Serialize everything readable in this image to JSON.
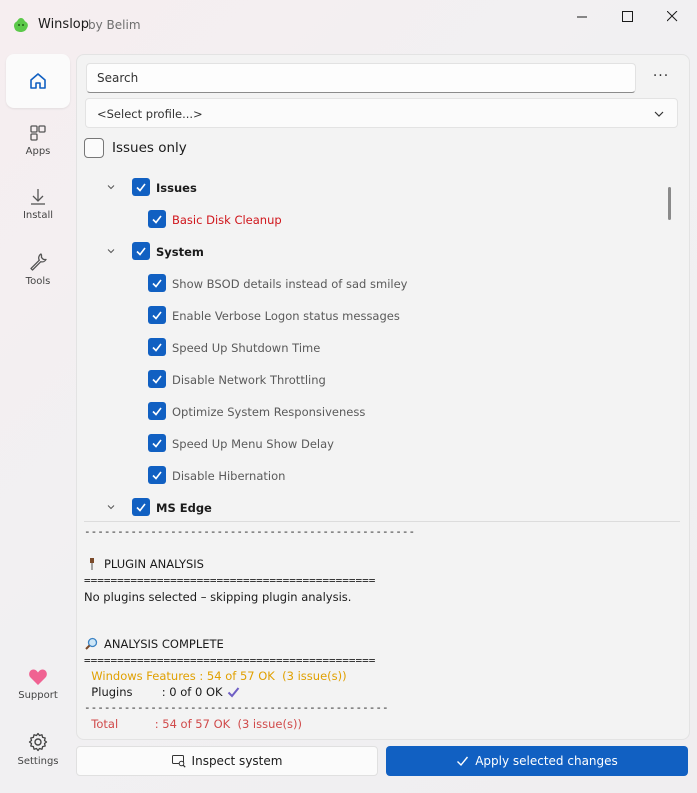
{
  "window": {
    "title": "Winslop",
    "subtitle": "by Belim",
    "buttons": [
      "minimize",
      "maximize",
      "close"
    ]
  },
  "nav": {
    "items": [
      {
        "name": "home",
        "label": "",
        "icon": "home-icon",
        "active": true
      },
      {
        "name": "apps",
        "label": "Apps",
        "icon": "apps-icon"
      },
      {
        "name": "install",
        "label": "Install",
        "icon": "download-icon"
      },
      {
        "name": "tools",
        "label": "Tools",
        "icon": "wrench-icon"
      }
    ],
    "bottom": [
      {
        "name": "support",
        "label": "Support",
        "icon": "heart-icon"
      },
      {
        "name": "settings",
        "label": "Settings",
        "icon": "gear-icon"
      }
    ]
  },
  "search": {
    "placeholder": "Search",
    "more_label": "···"
  },
  "profile_select": {
    "value": "<Select profile...>"
  },
  "issues_only": {
    "label": "Issues only",
    "checked": false
  },
  "tree": {
    "groups": [
      {
        "label": "Issues",
        "items": [
          {
            "label": "Basic Disk Cleanup",
            "issue": true
          }
        ]
      },
      {
        "label": "System",
        "items": [
          {
            "label": "Show BSOD details instead of sad smiley"
          },
          {
            "label": "Enable Verbose Logon status messages"
          },
          {
            "label": "Speed Up Shutdown Time"
          },
          {
            "label": "Disable Network Throttling"
          },
          {
            "label": "Optimize System Responsiveness"
          },
          {
            "label": "Speed Up Menu Show Delay"
          },
          {
            "label": "Disable Hibernation"
          }
        ]
      },
      {
        "label": "MS Edge",
        "items": []
      }
    ]
  },
  "log": {
    "sep_dash_top": "--------------------------------------------------",
    "plugin_title": "PLUGIN ANALYSIS",
    "sep_eq_1": "============================================",
    "plugin_msg": "No plugins selected – skipping plugin analysis.",
    "complete_title": "ANALYSIS COMPLETE",
    "sep_eq_2": "============================================",
    "features_line": "  Windows Features : 54 of 57 OK  (3 issue(s))",
    "plugins_line": "  Plugins        : 0 of 0 OK",
    "sep_dash_bottom": "----------------------------------------------",
    "total_line": "  Total          : 54 of 57 OK  (3 issue(s))"
  },
  "actions": {
    "inspect_label": "Inspect system",
    "apply_label": "Apply selected changes"
  },
  "colors": {
    "accent": "#1160c2",
    "issue_red": "#d0161c",
    "warn_orange": "#e0a000",
    "support_heart": "#f06292"
  }
}
